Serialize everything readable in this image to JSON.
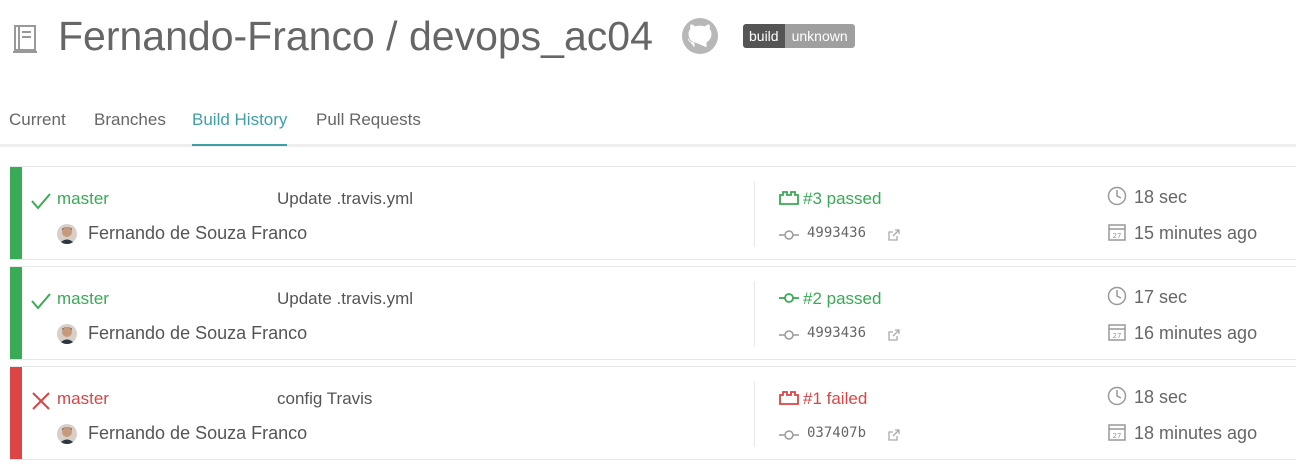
{
  "header": {
    "owner": "Fernando-Franco",
    "separator": " / ",
    "repo": "devops_ac04",
    "repo_icon": "repo-book-icon",
    "github_icon": "github-icon",
    "badge": {
      "label": "build",
      "status": "unknown"
    }
  },
  "tabs": [
    {
      "label": "Current",
      "active": false
    },
    {
      "label": "Branches",
      "active": false
    },
    {
      "label": "Build History",
      "active": true
    },
    {
      "label": "Pull Requests",
      "active": false
    }
  ],
  "colors": {
    "passed": "#39aa56",
    "failed": "#db4545",
    "accent": "#3ea0a7"
  },
  "builds": [
    {
      "state": "passed",
      "branch": "master",
      "message": "Update .travis.yml",
      "author": "Fernando de Souza Franco",
      "build": "#3 passed",
      "build_icon": "push-icon",
      "commit": "4993436",
      "duration": "18 sec",
      "finished": "15 minutes ago"
    },
    {
      "state": "passed",
      "branch": "master",
      "message": "Update .travis.yml",
      "author": "Fernando de Souza Franco",
      "build": "#2 passed",
      "build_icon": "commit-icon",
      "commit": "4993436",
      "duration": "17 sec",
      "finished": "16 minutes ago"
    },
    {
      "state": "failed",
      "branch": "master",
      "message": "config Travis",
      "author": "Fernando de Souza Franco",
      "build": "#1 failed",
      "build_icon": "push-icon",
      "commit": "037407b",
      "duration": "18 sec",
      "finished": "18 minutes ago"
    }
  ]
}
